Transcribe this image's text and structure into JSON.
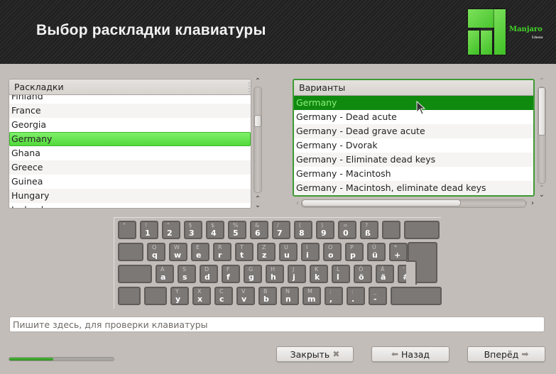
{
  "header": {
    "title": "Выбор раскладки клавиатуры",
    "logo_name": "Manjaro",
    "logo_sub": "Linux",
    "logo_icon": "manjaro-logo-icon"
  },
  "layouts": {
    "header": "Раскладки",
    "items": [
      "Finland",
      "France",
      "Georgia",
      "Germany",
      "Ghana",
      "Greece",
      "Guinea",
      "Hungary",
      "Iceland"
    ],
    "selected": "Germany"
  },
  "variants": {
    "header": "Варианты",
    "items": [
      "Germany",
      "Germany - Dead acute",
      "Germany - Dead grave acute",
      "Germany - Dvorak",
      "Germany - Eliminate dead keys",
      "Germany - Macintosh",
      "Germany - Macintosh, eliminate dead keys"
    ],
    "selected": "Germany"
  },
  "keyboard": {
    "rows": [
      [
        {
          "up": "°",
          "lo": ""
        },
        {
          "up": "!",
          "lo": "1"
        },
        {
          "up": "\"",
          "lo": "2"
        },
        {
          "up": "§",
          "lo": "3"
        },
        {
          "up": "$",
          "lo": "4"
        },
        {
          "up": "%",
          "lo": "5"
        },
        {
          "up": "&",
          "lo": "6"
        },
        {
          "up": "/",
          "lo": "7"
        },
        {
          "up": "(",
          "lo": "8"
        },
        {
          "up": ")",
          "lo": "9"
        },
        {
          "up": "=",
          "lo": "0"
        },
        {
          "up": "?",
          "lo": "ß"
        },
        {
          "up": "",
          "lo": ""
        },
        {
          "up": "",
          "lo": ""
        }
      ],
      [
        {
          "up": "",
          "lo": ""
        },
        {
          "up": "Q",
          "lo": "q"
        },
        {
          "up": "W",
          "lo": "w"
        },
        {
          "up": "E",
          "lo": "e"
        },
        {
          "up": "R",
          "lo": "r"
        },
        {
          "up": "T",
          "lo": "t"
        },
        {
          "up": "Z",
          "lo": "z"
        },
        {
          "up": "U",
          "lo": "u"
        },
        {
          "up": "I",
          "lo": "i"
        },
        {
          "up": "O",
          "lo": "o"
        },
        {
          "up": "P",
          "lo": "p"
        },
        {
          "up": "Ü",
          "lo": "ü"
        },
        {
          "up": "*",
          "lo": "+"
        }
      ],
      [
        {
          "up": "",
          "lo": ""
        },
        {
          "up": "A",
          "lo": "a"
        },
        {
          "up": "S",
          "lo": "s"
        },
        {
          "up": "D",
          "lo": "d"
        },
        {
          "up": "F",
          "lo": "f"
        },
        {
          "up": "G",
          "lo": "g"
        },
        {
          "up": "H",
          "lo": "h"
        },
        {
          "up": "J",
          "lo": "j"
        },
        {
          "up": "K",
          "lo": "k"
        },
        {
          "up": "L",
          "lo": "l"
        },
        {
          "up": "Ö",
          "lo": "ö"
        },
        {
          "up": "Ä",
          "lo": "ä"
        },
        {
          "up": "'",
          "lo": "#"
        }
      ],
      [
        {
          "up": "",
          "lo": ""
        },
        {
          "up": "",
          "lo": ""
        },
        {
          "up": "Y",
          "lo": "y"
        },
        {
          "up": "X",
          "lo": "x"
        },
        {
          "up": "C",
          "lo": "c"
        },
        {
          "up": "V",
          "lo": "v"
        },
        {
          "up": "B",
          "lo": "b"
        },
        {
          "up": "N",
          "lo": "n"
        },
        {
          "up": "M",
          "lo": "m"
        },
        {
          "up": ";",
          "lo": ","
        },
        {
          "up": ":",
          "lo": "."
        },
        {
          "up": "_",
          "lo": "-"
        },
        {
          "up": "",
          "lo": ""
        }
      ]
    ]
  },
  "test_input": {
    "placeholder": "Пишите здесь, для проверки клавиатуры",
    "value": ""
  },
  "progress": {
    "value_percent": 42
  },
  "buttons": {
    "close_label": "Закрыть",
    "close_icon": "close-x-icon",
    "back_label": "Назад",
    "back_icon": "arrow-left-icon",
    "next_label": "Вперёд",
    "next_icon": "arrow-right-icon"
  },
  "colors": {
    "accent_green": "#52d93b",
    "selection_dark_green": "#0f8a0f",
    "selection_text": "#8ef07a",
    "background": "#c2bdb9",
    "key_fill": "#7b7876"
  }
}
